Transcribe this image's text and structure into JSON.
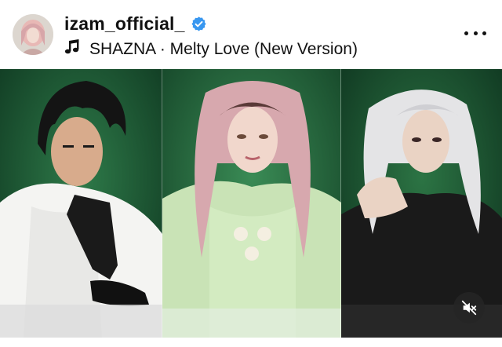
{
  "post": {
    "username": "izam_official_",
    "verified": true,
    "music": "SHAZNA · Melty Love (New Version)"
  },
  "icons": {
    "verified": "verified-badge-icon",
    "music": "music-note-icon",
    "more": "more-options-icon",
    "mute": "speaker-muted-icon"
  },
  "colors": {
    "verified_blue": "#3897f0",
    "background_green": "#1d5a33",
    "text": "#111111"
  }
}
